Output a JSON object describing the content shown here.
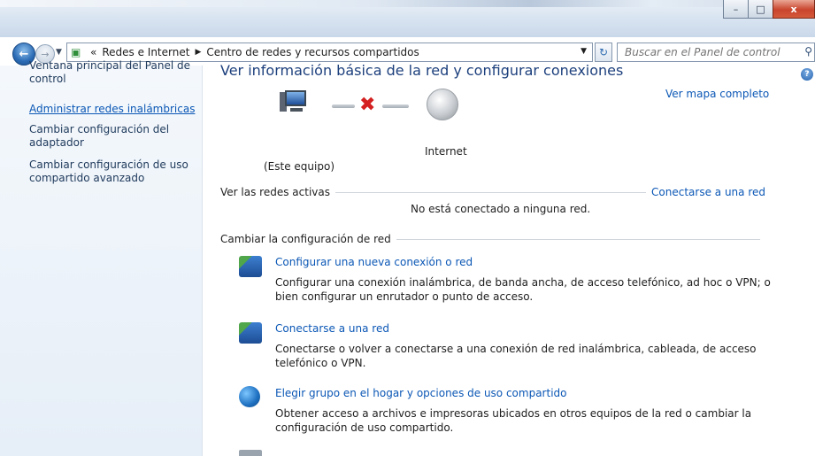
{
  "window": {
    "min": "–",
    "max": "□",
    "close": "x"
  },
  "nav": {
    "breadcrumb": [
      "Redes e Internet",
      "Centro de redes y recursos compartidos"
    ],
    "overflow": "«",
    "search_placeholder": "Buscar en el Panel de control"
  },
  "sidebar": {
    "items": [
      {
        "label": "Ventana principal del Panel de control"
      },
      {
        "label": "Administrar redes inalámbricas"
      },
      {
        "label": "Cambiar configuración del adaptador"
      },
      {
        "label": "Cambiar configuración de uso compartido avanzado"
      }
    ]
  },
  "main": {
    "title": "Ver información básica de la red y configurar conexiones",
    "map_link": "Ver mapa completo",
    "computer_label": "(Este equipo)",
    "internet_label": "Internet",
    "active_networks": {
      "title": "Ver las redes activas",
      "link": "Conectarse a una red",
      "status": "No está conectado a ninguna red."
    },
    "change_settings": {
      "title": "Cambiar la configuración de red"
    },
    "tasks": [
      {
        "title": "Configurar una nueva conexión o red",
        "desc": "Configurar una conexión inalámbrica, de banda ancha, de acceso telefónico, ad hoc o VPN; o bien configurar un enrutador o punto de acceso.",
        "icon": "network-setup-icon"
      },
      {
        "title": "Conectarse a una red",
        "desc": "Conectarse o volver a conectarse a una conexión de red inalámbrica, cableada, de acceso telefónico o VPN.",
        "icon": "network-connect-icon"
      },
      {
        "title": "Elegir grupo en el hogar y opciones de uso compartido",
        "desc": "Obtener acceso a archivos e impresoras ubicados en otros equipos de la red o cambiar la configuración de uso compartido.",
        "icon": "homegroup-icon"
      }
    ]
  }
}
